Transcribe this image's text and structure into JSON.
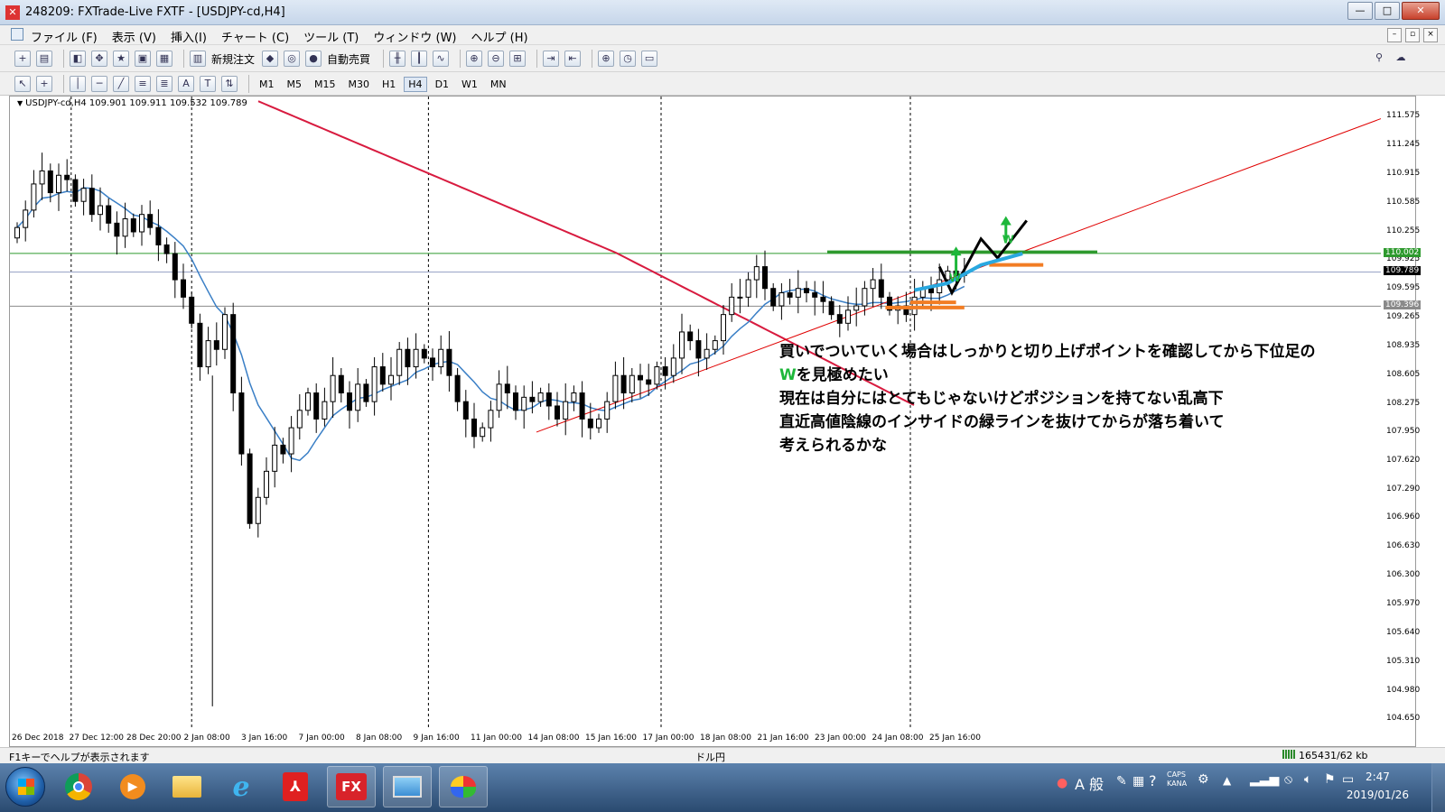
{
  "window": {
    "title": "248209: FXTrade-Live FXTF - [USDJPY-cd,H4]",
    "buttons": {
      "minimize": "—",
      "maximize": "□",
      "close": "✕"
    }
  },
  "menu": {
    "items": [
      "ファイル (F)",
      "表示 (V)",
      "挿入(I)",
      "チャート (C)",
      "ツール (T)",
      "ウィンドウ (W)",
      "ヘルプ (H)"
    ],
    "mdi": {
      "minimize": "–",
      "restore": "▫",
      "close": "×"
    }
  },
  "toolbar": {
    "new_order": "新規注文",
    "auto_trade": "自動売買",
    "timeframes": [
      "M1",
      "M5",
      "M15",
      "M30",
      "H1",
      "H4",
      "D1",
      "W1",
      "MN"
    ],
    "active_timeframe": "H4"
  },
  "chart": {
    "header": "USDJPY-cd,H4  109.901 109.911 109.532 109.789",
    "price_tags": {
      "green_line": "110.002",
      "current": "109.789",
      "gray_line": "109.396"
    },
    "annotation": {
      "line1": "買いでついていく場合はしっかりと切り上げポイントを確認してから下位足の",
      "line2_highlight": "W",
      "line2_rest": "を見極めたい",
      "line3": "現在は自分にはとてもじゃないけどポジションを持てない乱高下",
      "line4": "直近高値陰線のインサイドの緑ラインを抜けてからが落ち着いて",
      "line5": "考えられるかな"
    },
    "w_labels": [
      "W",
      "W"
    ],
    "colors": {
      "green_line": "#2e9a2e",
      "red_ma": "#d81b3f",
      "blue_ma": "#3a7fc6",
      "trend": "#e00000",
      "orange": "#f27d24",
      "cyan": "#29a8e0",
      "arrow": "#1db73a"
    }
  },
  "chart_data": {
    "type": "candlestick",
    "symbol": "USDJPY-cd",
    "timeframe": "H4",
    "y_ticks": [
      "111.575",
      "111.245",
      "110.915",
      "110.585",
      "110.255",
      "109.925",
      "109.595",
      "109.265",
      "108.935",
      "108.605",
      "108.275",
      "107.950",
      "107.620",
      "107.290",
      "106.960",
      "106.630",
      "106.300",
      "105.970",
      "105.640",
      "105.310",
      "104.980",
      "104.650"
    ],
    "x_ticks": [
      "26 Dec 2018",
      "27 Dec 12:00",
      "28 Dec 20:00",
      "2 Jan 08:00",
      "3 Jan 16:00",
      "7 Jan 00:00",
      "8 Jan 08:00",
      "9 Jan 16:00",
      "11 Jan 00:00",
      "14 Jan 08:00",
      "15 Jan 16:00",
      "17 Jan 00:00",
      "18 Jan 08:00",
      "21 Jan 16:00",
      "23 Jan 00:00",
      "24 Jan 08:00",
      "25 Jan 16:00"
    ],
    "ylim": [
      104.55,
      111.68
    ],
    "horizontal_levels": [
      110.002,
      109.789,
      109.396
    ],
    "closes": [
      110.3,
      110.5,
      110.8,
      110.95,
      110.7,
      110.9,
      110.85,
      110.6,
      110.75,
      110.45,
      110.55,
      110.35,
      110.2,
      110.4,
      110.25,
      110.45,
      110.3,
      110.1,
      110.0,
      109.7,
      109.5,
      109.2,
      108.7,
      109.0,
      108.9,
      109.3,
      108.4,
      107.7,
      106.9,
      107.2,
      107.5,
      107.8,
      107.7,
      108.0,
      108.2,
      108.4,
      108.1,
      108.3,
      108.6,
      108.4,
      108.2,
      108.5,
      108.3,
      108.7,
      108.5,
      108.6,
      108.9,
      108.7,
      108.9,
      108.8,
      108.7,
      108.9,
      108.6,
      108.3,
      108.1,
      107.9,
      108.0,
      108.2,
      108.5,
      108.4,
      108.2,
      108.35,
      108.3,
      108.4,
      108.25,
      108.1,
      108.3,
      108.4,
      108.1,
      108.0,
      108.1,
      108.3,
      108.6,
      108.4,
      108.6,
      108.55,
      108.5,
      108.7,
      108.6,
      108.8,
      109.1,
      109.0,
      108.8,
      108.9,
      109.0,
      109.3,
      109.5,
      109.5,
      109.7,
      109.85,
      109.6,
      109.4,
      109.55,
      109.5,
      109.6,
      109.55,
      109.5,
      109.45,
      109.3,
      109.2,
      109.35,
      109.4,
      109.6,
      109.7,
      109.5,
      109.35,
      109.4,
      109.3,
      109.5,
      109.6,
      109.55,
      109.7,
      109.8,
      109.75,
      109.79
    ]
  },
  "status": {
    "help": "F1キーでヘルプが表示されます",
    "pair": "ドル円",
    "traffic": "165431/62 kb"
  },
  "taskbar": {
    "apps": [
      "chrome",
      "media",
      "explorer",
      "ie",
      "pdf",
      "FX",
      "photo",
      "paint"
    ],
    "fx_label": "FX",
    "ime": "A 般",
    "caps": "CAPS",
    "kana": "KANA",
    "time": "2:47",
    "date": "2019/01/26"
  }
}
